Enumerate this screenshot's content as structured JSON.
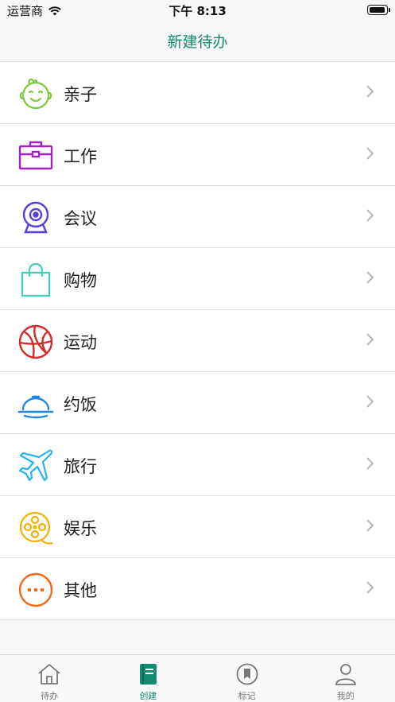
{
  "status_bar": {
    "carrier": "运营商",
    "time": "下午 8:13"
  },
  "nav": {
    "title": "新建待办"
  },
  "list": [
    {
      "label": "亲子",
      "icon": "baby-face-icon",
      "color": "#7ac943"
    },
    {
      "label": "工作",
      "icon": "briefcase-icon",
      "color": "#a321c4"
    },
    {
      "label": "会议",
      "icon": "webcam-icon",
      "color": "#5b3ce0"
    },
    {
      "label": "购物",
      "icon": "shopping-bag-icon",
      "color": "#3bd0b8"
    },
    {
      "label": "运动",
      "icon": "basketball-icon",
      "color": "#d42a2a"
    },
    {
      "label": "约饭",
      "icon": "food-cloche-icon",
      "color": "#1d86e8"
    },
    {
      "label": "旅行",
      "icon": "airplane-icon",
      "color": "#26b4ee"
    },
    {
      "label": "娱乐",
      "icon": "film-reel-icon",
      "color": "#f2b000"
    },
    {
      "label": "其他",
      "icon": "more-dots-icon",
      "color": "#f06a13"
    }
  ],
  "tabs": [
    {
      "label": "待办",
      "icon": "home-icon"
    },
    {
      "label": "创建",
      "icon": "book-icon",
      "active": true
    },
    {
      "label": "标记",
      "icon": "bookmark-icon"
    },
    {
      "label": "我的",
      "icon": "person-icon"
    }
  ],
  "colors": {
    "accent": "#138a72"
  }
}
